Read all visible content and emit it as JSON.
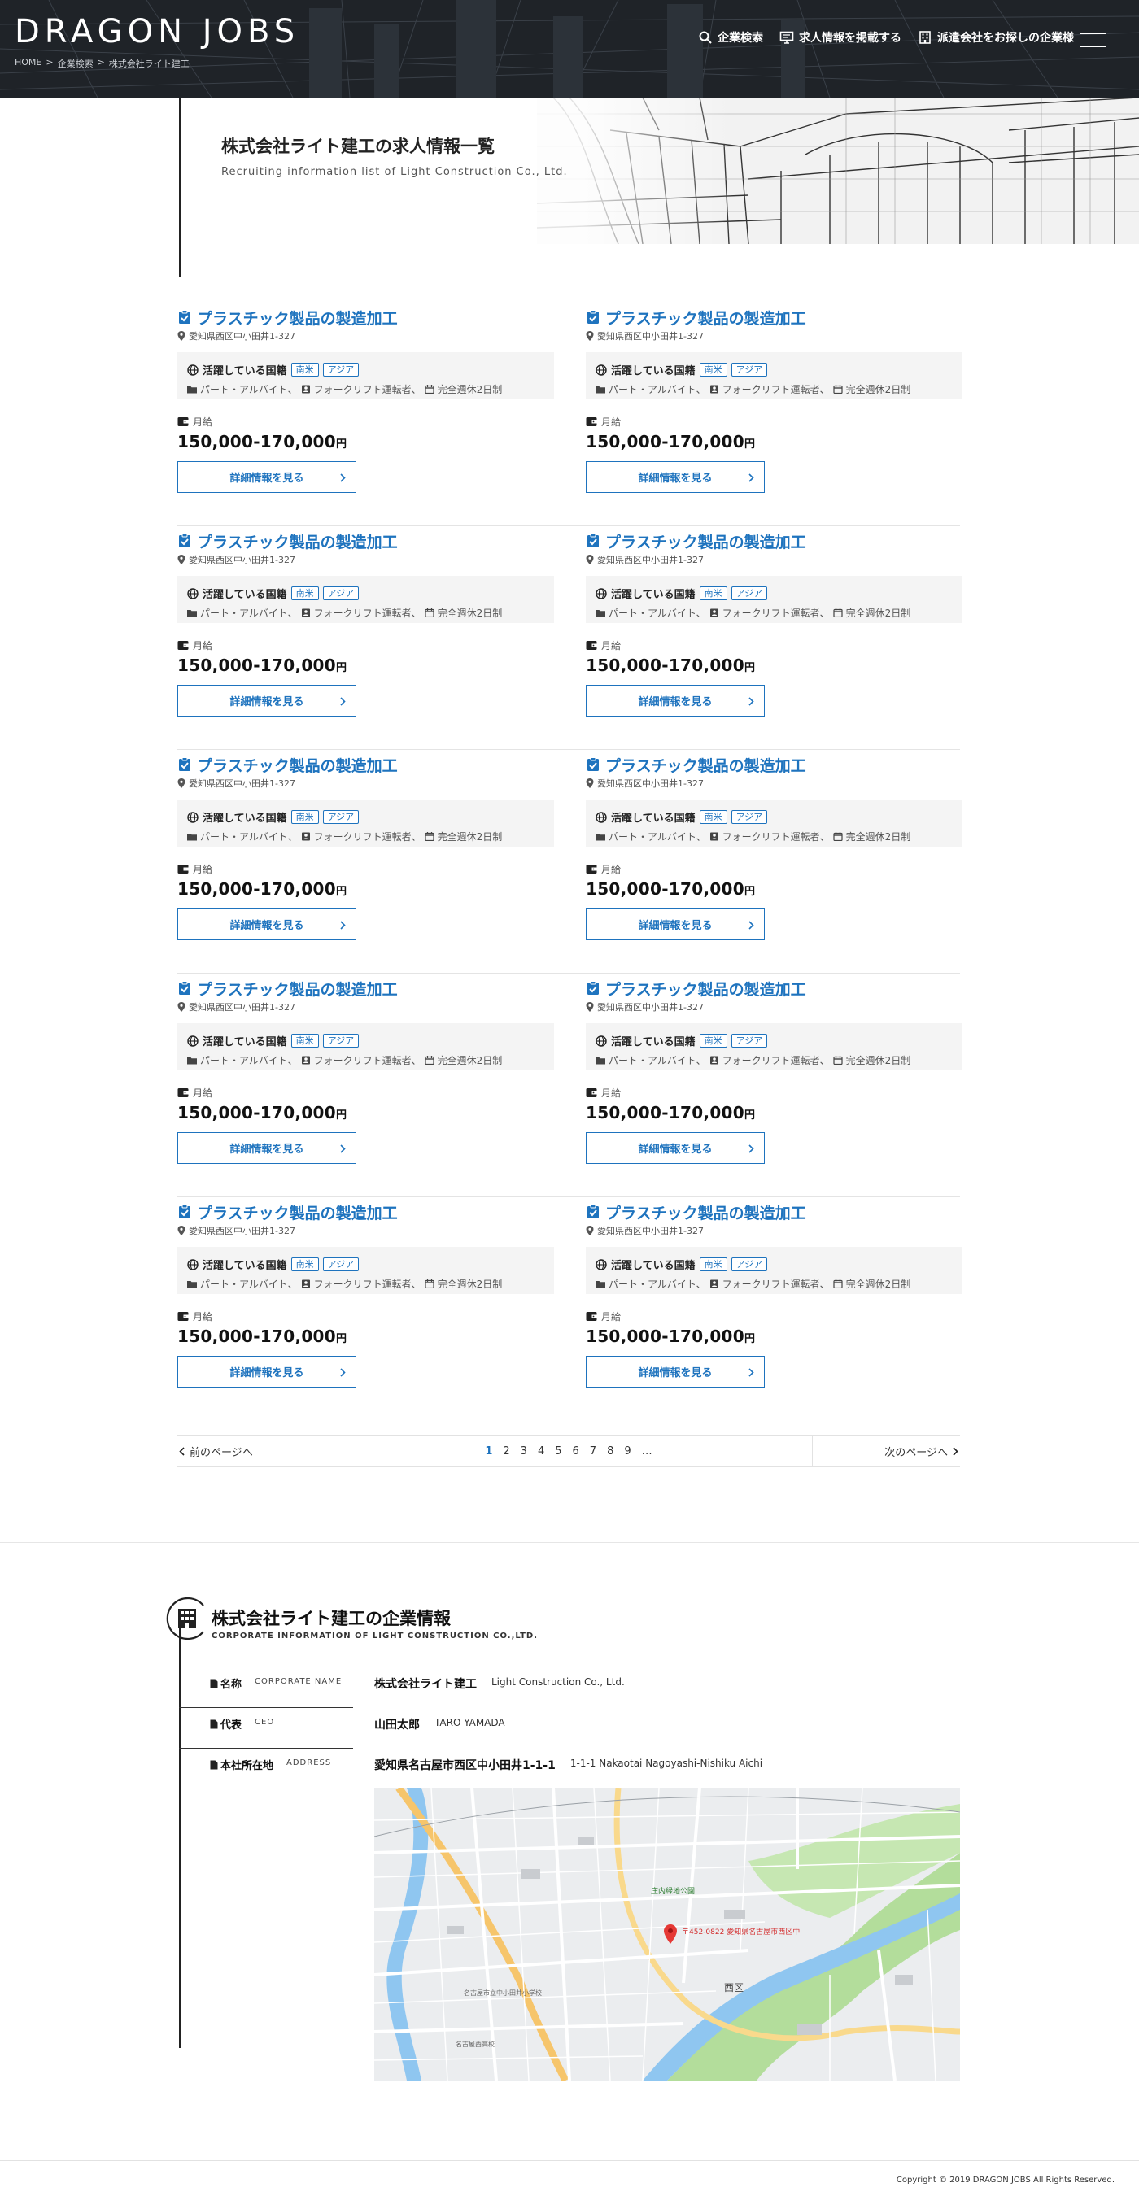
{
  "header": {
    "logo": "DRAGON JOBS",
    "breadcrumb": [
      "HOME",
      ">",
      "企業検索",
      ">",
      "株式会社ライト建工"
    ],
    "nav": [
      {
        "label": "企業検索",
        "icon": "search-icon"
      },
      {
        "label": "求人情報を掲載する",
        "icon": "monitor-icon"
      },
      {
        "label": "派遣会社をお探しの企業様",
        "icon": "building-icon"
      }
    ],
    "menu_icon": "hamburger-icon"
  },
  "hero": {
    "title": "株式会社ライト建工の求人情報一覧",
    "subtitle": "Recruiting information list of Light Construction Co., Ltd."
  },
  "job_common": {
    "countries_label": "活躍している国籍",
    "salary_label": "月給",
    "yen": "円",
    "button_label": "詳細情報を見る",
    "accent_color": "#1e73be"
  },
  "jobs": [
    {
      "title": "プラスチック製品の製造加工",
      "location": "愛知県西区中小田井1-327",
      "tags": [
        "南米",
        "アジア"
      ],
      "conditions": [
        "パート・アルバイト、",
        "フォークリフト運転者、",
        "完全週休2日制"
      ],
      "salary": "150,000-170,000"
    },
    {
      "title": "プラスチック製品の製造加工",
      "location": "愛知県西区中小田井1-327",
      "tags": [
        "南米",
        "アジア"
      ],
      "conditions": [
        "パート・アルバイト、",
        "フォークリフト運転者、",
        "完全週休2日制"
      ],
      "salary": "150,000-170,000"
    },
    {
      "title": "プラスチック製品の製造加工",
      "location": "愛知県西区中小田井1-327",
      "tags": [
        "南米",
        "アジア"
      ],
      "conditions": [
        "パート・アルバイト、",
        "フォークリフト運転者、",
        "完全週休2日制"
      ],
      "salary": "150,000-170,000"
    },
    {
      "title": "プラスチック製品の製造加工",
      "location": "愛知県西区中小田井1-327",
      "tags": [
        "南米",
        "アジア"
      ],
      "conditions": [
        "パート・アルバイト、",
        "フォークリフト運転者、",
        "完全週休2日制"
      ],
      "salary": "150,000-170,000"
    },
    {
      "title": "プラスチック製品の製造加工",
      "location": "愛知県西区中小田井1-327",
      "tags": [
        "南米",
        "アジア"
      ],
      "conditions": [
        "パート・アルバイト、",
        "フォークリフト運転者、",
        "完全週休2日制"
      ],
      "salary": "150,000-170,000"
    },
    {
      "title": "プラスチック製品の製造加工",
      "location": "愛知県西区中小田井1-327",
      "tags": [
        "南米",
        "アジア"
      ],
      "conditions": [
        "パート・アルバイト、",
        "フォークリフト運転者、",
        "完全週休2日制"
      ],
      "salary": "150,000-170,000"
    },
    {
      "title": "プラスチック製品の製造加工",
      "location": "愛知県西区中小田井1-327",
      "tags": [
        "南米",
        "アジア"
      ],
      "conditions": [
        "パート・アルバイト、",
        "フォークリフト運転者、",
        "完全週休2日制"
      ],
      "salary": "150,000-170,000"
    },
    {
      "title": "プラスチック製品の製造加工",
      "location": "愛知県西区中小田井1-327",
      "tags": [
        "南米",
        "アジア"
      ],
      "conditions": [
        "パート・アルバイト、",
        "フォークリフト運転者、",
        "完全週休2日制"
      ],
      "salary": "150,000-170,000"
    },
    {
      "title": "プラスチック製品の製造加工",
      "location": "愛知県西区中小田井1-327",
      "tags": [
        "南米",
        "アジア"
      ],
      "conditions": [
        "パート・アルバイト、",
        "フォークリフト運転者、",
        "完全週休2日制"
      ],
      "salary": "150,000-170,000"
    },
    {
      "title": "プラスチック製品の製造加工",
      "location": "愛知県西区中小田井1-327",
      "tags": [
        "南米",
        "アジア"
      ],
      "conditions": [
        "パート・アルバイト、",
        "フォークリフト運転者、",
        "完全週休2日制"
      ],
      "salary": "150,000-170,000"
    }
  ],
  "pagination": {
    "prev": "前のページへ",
    "next": "次のページへ",
    "pages": [
      "1",
      "2",
      "3",
      "4",
      "5",
      "6",
      "7",
      "8",
      "9",
      "…"
    ],
    "current": "1"
  },
  "company": {
    "title": "株式会社ライト建工の企業情報",
    "subtitle": "CORPORATE INFORMATION OF LIGHT CONSTRUCTION CO.,LTD.",
    "rows": [
      {
        "label": "名称",
        "label_en": "CORPORATE NAME",
        "value": "株式会社ライト建工",
        "value_en": "Light Construction Co., Ltd."
      },
      {
        "label": "代表",
        "label_en": "CEO",
        "value": "山田太郎",
        "value_en": "TARO YAMADA"
      },
      {
        "label": "本社所在地",
        "label_en": "ADDRESS",
        "value": "愛知県名古屋市西区中小田井1-1-1",
        "value_en": "1-1-1 Nakaotai Nagoyashi-Nishiku Aichi"
      }
    ],
    "map": {
      "pin_label": "〒452-0822 愛知県名古屋市西区中",
      "places": [
        "西区",
        "庄内緑地公園",
        "名古屋市立中小田井小学校",
        "名古屋西高校"
      ]
    }
  },
  "footer": {
    "copyright": "Copyright © 2019 DRAGON JOBS All Rights Reserved."
  }
}
